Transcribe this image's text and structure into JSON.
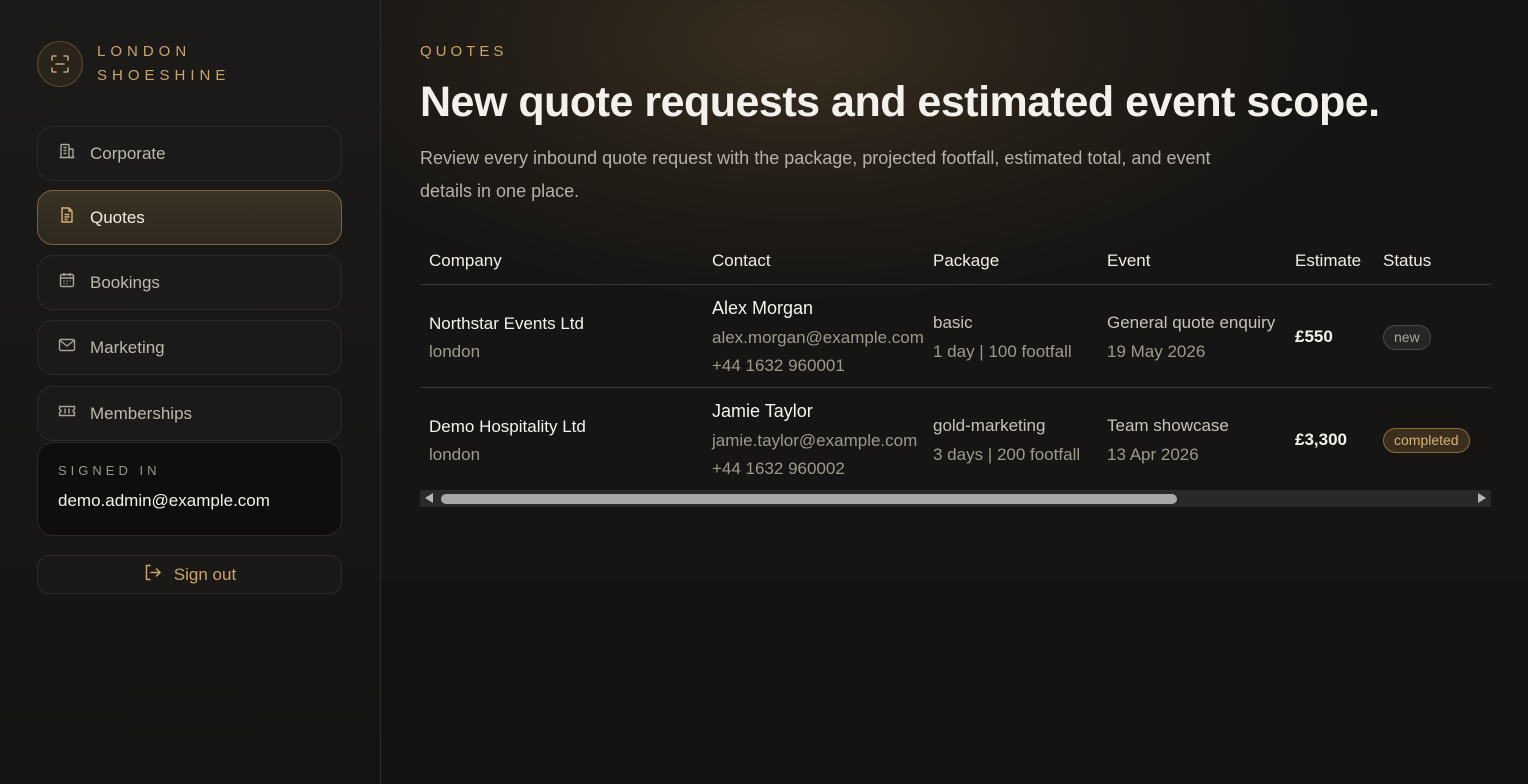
{
  "brand": {
    "line1": "LONDON",
    "line2": "SHOESHINE",
    "icon": "scan-icon"
  },
  "nav": [
    {
      "label": "Corporate",
      "icon": "building-icon",
      "active": false
    },
    {
      "label": "Quotes",
      "icon": "document-icon",
      "active": true
    },
    {
      "label": "Bookings",
      "icon": "calendar-icon",
      "active": false
    },
    {
      "label": "Marketing",
      "icon": "mail-icon",
      "active": false
    },
    {
      "label": "Memberships",
      "icon": "ticket-icon",
      "active": false
    }
  ],
  "session": {
    "caption": "SIGNED IN",
    "email": "demo.admin@example.com"
  },
  "signout": {
    "label": "Sign out",
    "icon": "logout-icon"
  },
  "page": {
    "eyebrow": "QUOTES",
    "title": "New quote requests and estimated event scope.",
    "description": "Review every inbound quote request with the package, projected footfall, estimated total, and event details in one place."
  },
  "table": {
    "headers": [
      "Company",
      "Contact",
      "Package",
      "Event",
      "Estimate",
      "Status"
    ],
    "rows": [
      {
        "company": "Northstar Events Ltd",
        "city": "london",
        "contact_name": "Alex Morgan",
        "contact_email": "alex.morgan@example.com",
        "contact_phone": "+44 1632 960001",
        "package": "basic",
        "package_detail": "1 day | 100 footfall",
        "event": "General quote enquiry",
        "event_date": "19 May 2026",
        "estimate": "£550",
        "status": "new"
      },
      {
        "company": "Demo Hospitality Ltd",
        "city": "london",
        "contact_name": "Jamie Taylor",
        "contact_email": "jamie.taylor@example.com",
        "contact_phone": "+44 1632 960002",
        "package": "gold-marketing",
        "package_detail": "3 days | 200 footfall",
        "event": "Team showcase",
        "event_date": "13 Apr 2026",
        "estimate": "£3,300",
        "status": "completed"
      }
    ]
  },
  "colors": {
    "accent": "#c9a56a",
    "background": "#141312"
  }
}
